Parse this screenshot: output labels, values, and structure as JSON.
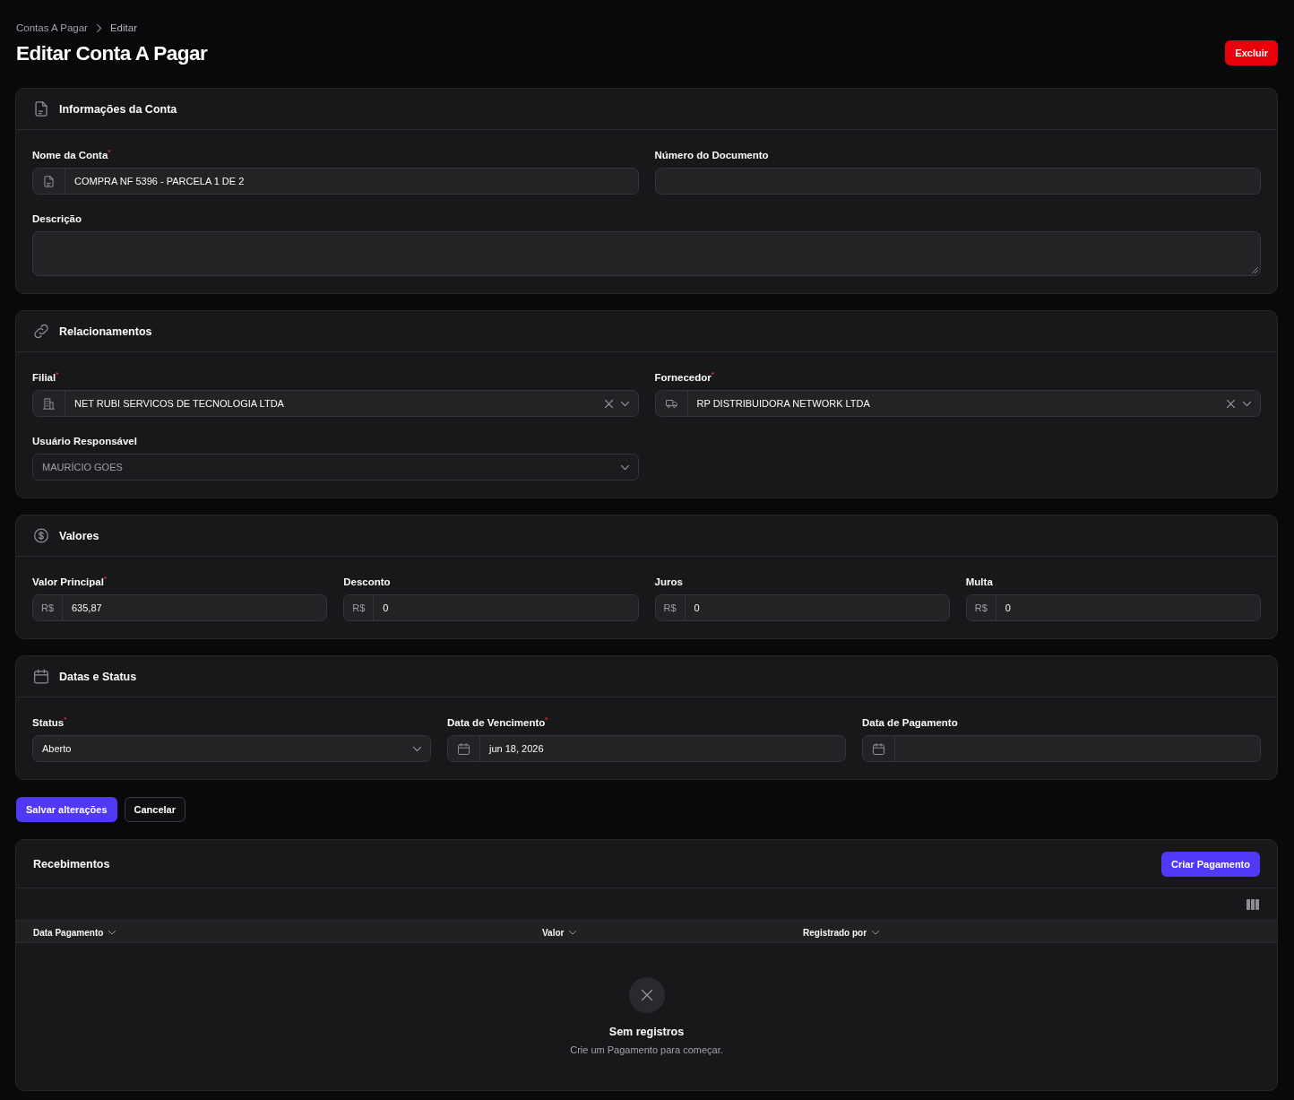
{
  "breadcrumbs": [
    "Contas A Pagar",
    "Editar"
  ],
  "title": "Editar Conta A Pagar",
  "delete_button": "Excluir",
  "sections": [
    {
      "title": "Informações da Conta",
      "fields": [
        {
          "label": "Nome da Conta$^{*}$",
          "kind": "text",
          "value": "COMPRA NF 5396 - PARCELA 1 DE 2"
        },
        {
          "label": "Número do Documento",
          "kind": "text"
        },
        {
          "label": "Descrição",
          "kind": "textarea"
        }
      ]
    },
    {
      "title": "Relacionamentos",
      "fields": [
        {
          "label": "Filial$^{*}$",
          "kind": "select",
          "value": "NET RUBI SERVICOS DE TECNOLOGIA LTDA",
          "clearable": true,
          "disabled": false
        },
        {
          "label": "Fornecedor$^{*}$",
          "kind": "select",
          "value": "RP DISTRIBUIDORA NETWORK LTDA",
          "clearable": true,
          "disabled": false
        },
        {
          "label": "Usuário Responsável",
          "kind": "select",
          "value": "MAURÍCIO GOES",
          "clearable": false,
          "disabled": true
        }
      ]
    },
    {
      "title": "Valores",
      "fields": [
        {
          "label": "Valor Principal$^{*}$",
          "kind": "money",
          "prefix": "R$",
          "value": "635,87"
        },
        {
          "label": "Desconto",
          "kind": "money",
          "prefix": "R$",
          "value": "0"
        },
        {
          "label": "Juros",
          "kind": "money",
          "prefix": "R$",
          "value": "0"
        },
        {
          "label": "Multa",
          "kind": "money",
          "prefix": "R$",
          "value": "0"
        }
      ]
    },
    {
      "title": "Datas e Status",
      "fields": [
        {
          "label": "Status$^{*}$",
          "kind": "select",
          "value": "Aberto",
          "clearable": false,
          "disabled": false
        },
        {
          "label": "Data de Vencimento$^{*}$",
          "kind": "date",
          "value": "jun 18, 2026"
        },
        {
          "label": "Data de Pagamento",
          "kind": "date"
        }
      ]
    }
  ],
  "actions": [
    {
      "label": "Salvar alterações",
      "kind": "primary"
    },
    {
      "label": "Cancelar",
      "kind": "secondary"
    }
  ],
  "receipts": {
    "title": "Recebimentos",
    "create_button": "Criar Pagamento",
    "columns": [
      "Data Pagamento",
      "Valor",
      "Registrado por"
    ],
    "empty_title": "Sem registros",
    "empty_text": "Crie um Pagamento para começar."
  }
}
